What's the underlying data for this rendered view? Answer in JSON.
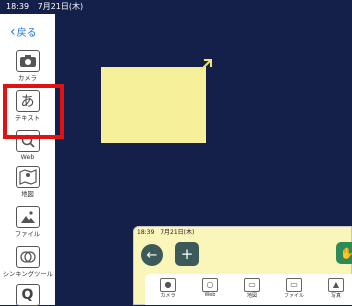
{
  "status": {
    "time": "18:39",
    "date": "7月21日(木)"
  },
  "sidebar": {
    "back_label": "戻る",
    "tools": [
      {
        "label": "カメラ",
        "icon": "camera-icon"
      },
      {
        "label": "テキスト",
        "icon": "text-icon",
        "glyph": "あ"
      },
      {
        "label": "Web",
        "icon": "web-search-icon"
      },
      {
        "label": "地図",
        "icon": "map-icon"
      },
      {
        "label": "ファイル",
        "icon": "file-image-icon"
      },
      {
        "label": "シンキングツール",
        "icon": "thinking-tool-icon"
      },
      {
        "label": "",
        "icon": "q-icon",
        "glyph": "Q"
      }
    ]
  },
  "inset": {
    "status": {
      "time": "18:39",
      "date": "7月21日(木)"
    },
    "tools": [
      {
        "label": "カメラ",
        "icon": "camera-icon"
      },
      {
        "label": "Web",
        "icon": "web-search-icon"
      },
      {
        "label": "地図",
        "icon": "map-icon"
      },
      {
        "label": "ファイル",
        "icon": "folder-icon"
      },
      {
        "label": "写真",
        "icon": "photo-icon"
      }
    ]
  },
  "colors": {
    "canvas": "#14204a",
    "sticky": "#f7f09a",
    "highlight": "#e11212",
    "accent": "#1a73e8"
  }
}
